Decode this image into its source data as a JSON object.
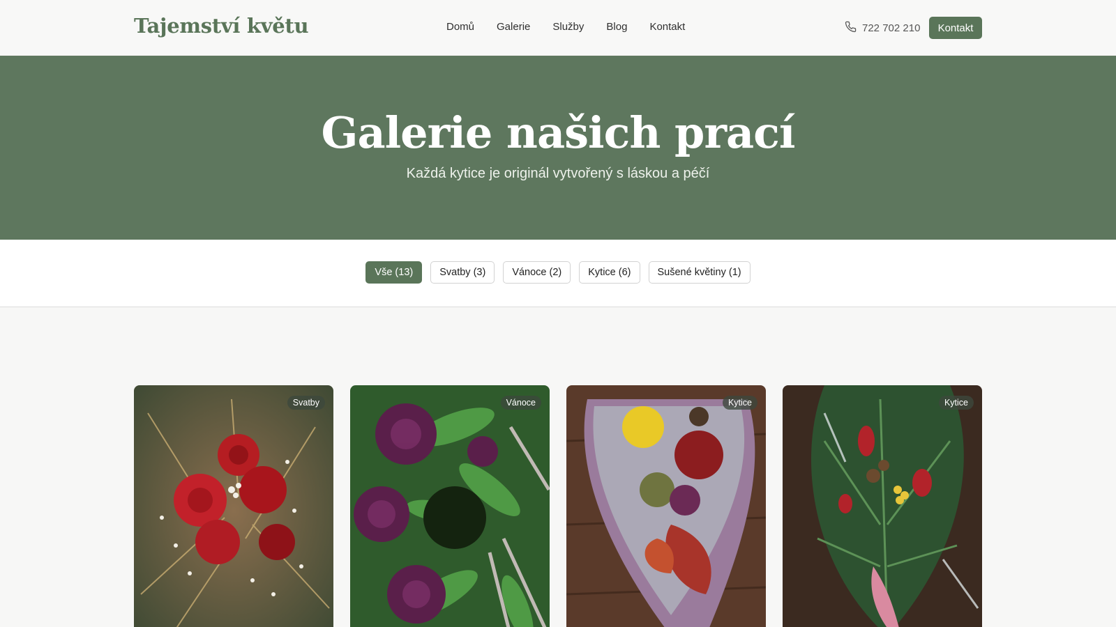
{
  "header": {
    "logo": "Tajemství květu",
    "nav": [
      "Domů",
      "Galerie",
      "Služby",
      "Blog",
      "Kontakt"
    ],
    "phone": "722 702 210",
    "cta": "Kontakt"
  },
  "hero": {
    "title": "Galerie našich prací",
    "subtitle": "Každá kytice je originál vytvořený s láskou a péčí"
  },
  "filters": [
    {
      "label": "Vše (13)",
      "active": true
    },
    {
      "label": "Svatby (3)",
      "active": false
    },
    {
      "label": "Vánoce (2)",
      "active": false
    },
    {
      "label": "Kytice (6)",
      "active": false
    },
    {
      "label": "Sušené květiny (1)",
      "active": false
    }
  ],
  "gallery": [
    {
      "badge": "Svatby"
    },
    {
      "badge": "Vánoce"
    },
    {
      "badge": "Kytice"
    },
    {
      "badge": "Kytice"
    }
  ],
  "colors": {
    "accent": "#5a7559",
    "hero_bg": "#5e775e"
  },
  "icons": {
    "phone": "phone-icon"
  }
}
